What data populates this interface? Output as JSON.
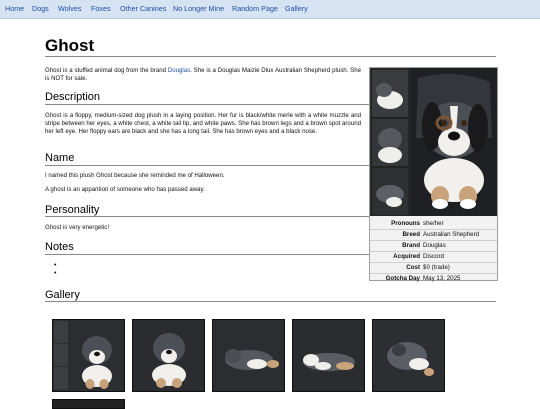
{
  "nav": {
    "items": [
      "Home",
      "Dogs",
      "Wolves",
      "Foxes",
      "Other Canines",
      "No Longer Mine",
      "Random Page",
      "Gallery"
    ]
  },
  "page": {
    "title": "Ghost",
    "intro_before": "Ghost is a stuffed animal dog from the brand ",
    "intro_link": "Douglas",
    "intro_after": ". She is a Douglas Maizie Dlux Australian Shepherd plush. She is NOT for sale."
  },
  "sections": {
    "description": {
      "heading": "Description",
      "text": "Ghost is a floppy, medium-sized dog plush in a laying position. Her fur is black/white merle with a white muzzle and stripe between her eyes, a white chest, a white tail tip, and white paws. She has brown legs and a brown spot around her left eye. Her floppy ears are black and she has a long tail. She has brown eyes and a black nose."
    },
    "name": {
      "heading": "Name",
      "text1": "I named this plush Ghost because she reminded me of Halloween.",
      "text2": "A ghost is an apparition of someone who has passed away."
    },
    "personality": {
      "heading": "Personality",
      "text": "Ghost is very energetic!"
    },
    "notes": {
      "heading": "Notes",
      "bullets": [
        "•",
        "•"
      ]
    },
    "gallery": {
      "heading": "Gallery"
    }
  },
  "infobox": {
    "rows": [
      {
        "label": "Pronouns",
        "value": "she/her"
      },
      {
        "label": "Breed",
        "value": "Australian Shepherd"
      },
      {
        "label": "Brand",
        "value": "Douglas"
      },
      {
        "label": "Acquired",
        "value": "Discord"
      },
      {
        "label": "Cost",
        "value": "$0 (trade)"
      },
      {
        "label": "Gotcha Day",
        "value": "May 13, 2025"
      }
    ]
  },
  "colors": {
    "nav_bg": "#d6e3f2",
    "link": "#1f4fa8",
    "infobox_bg": "#f2f2f2"
  }
}
